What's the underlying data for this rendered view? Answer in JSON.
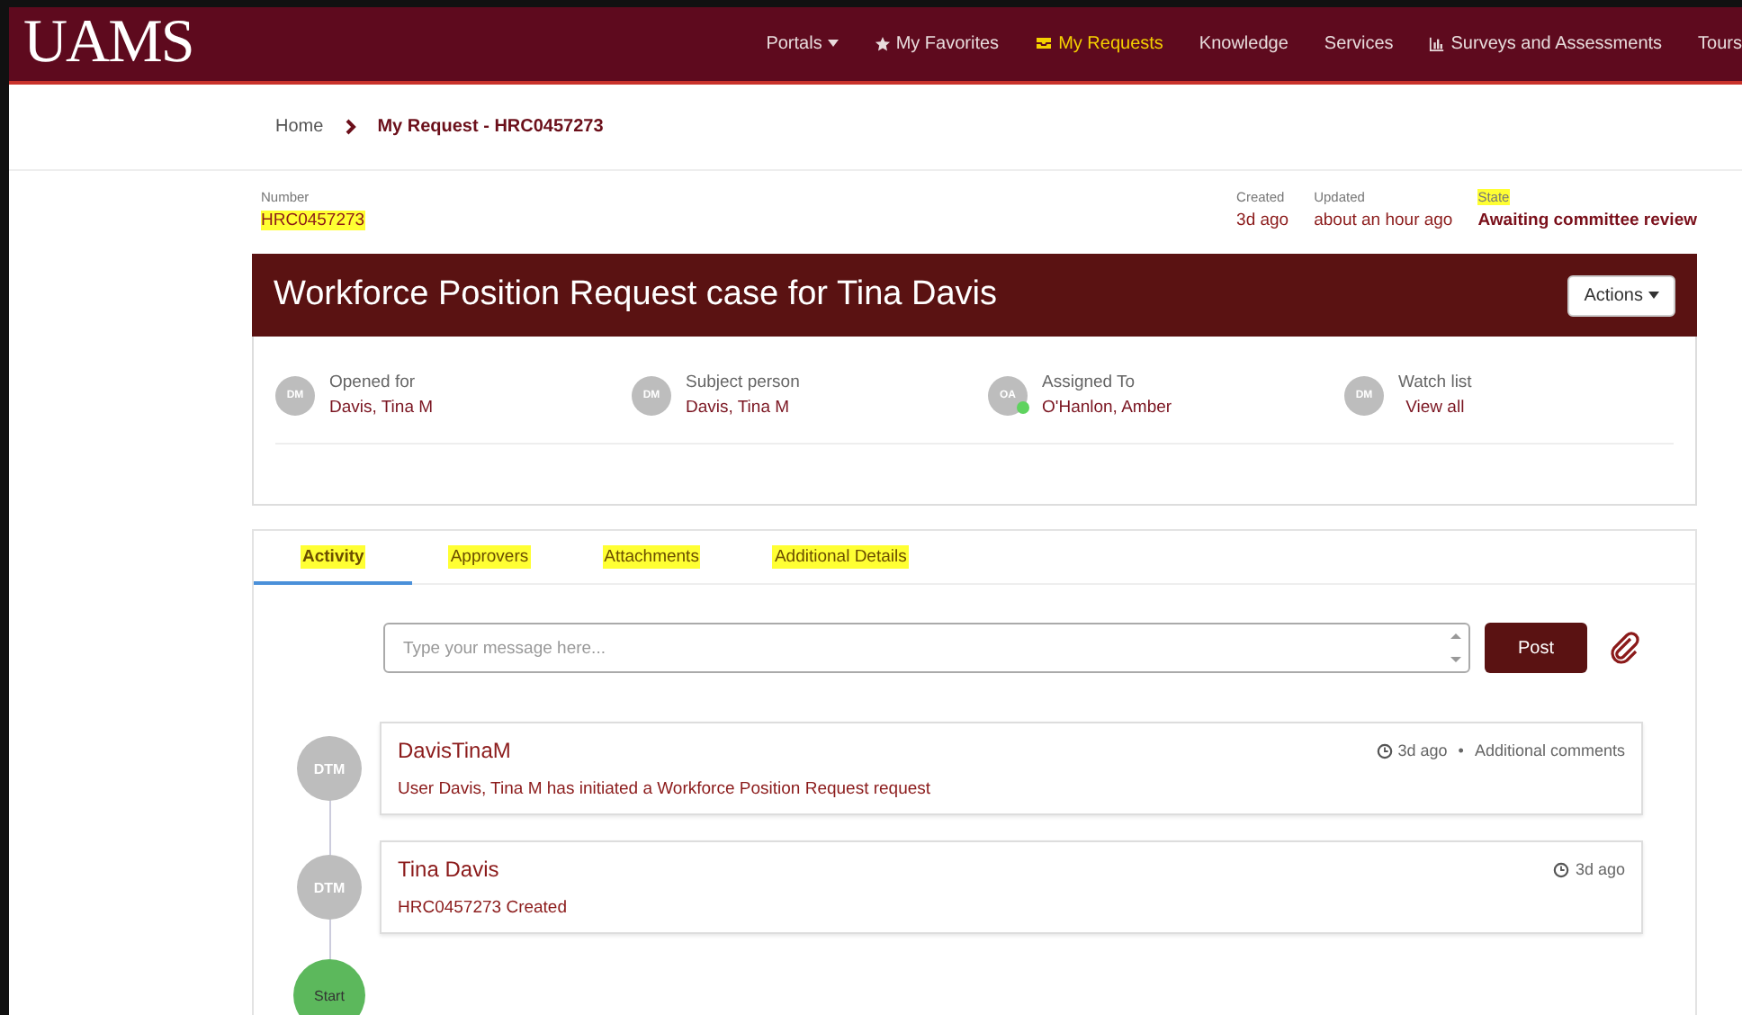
{
  "nav": {
    "logo": "UAMS",
    "items": [
      {
        "label": "Portals",
        "kind": "dropdown",
        "selected": false
      },
      {
        "label": "My Favorites",
        "kind": "favorites",
        "selected": false
      },
      {
        "label": "My Requests",
        "kind": "requests",
        "selected": true
      },
      {
        "label": "Knowledge",
        "kind": "plain",
        "selected": false
      },
      {
        "label": "Services",
        "kind": "plain",
        "selected": false
      },
      {
        "label": "Surveys and Assessments",
        "kind": "surveys",
        "selected": false
      },
      {
        "label": "Tours",
        "kind": "plain",
        "selected": false
      }
    ]
  },
  "breadcrumb": [
    {
      "label": "Home",
      "current": false
    },
    {
      "label": "My Request - HRC0457273",
      "current": true
    }
  ],
  "record": {
    "number": {
      "label": "Number",
      "value": "HRC0457273",
      "highlighted": true
    },
    "meta": [
      {
        "label": "Created",
        "value": "3d ago",
        "highlighted": false,
        "emphasis": false
      },
      {
        "label": "Updated",
        "value": "about an hour ago",
        "highlighted": false,
        "emphasis": false
      },
      {
        "label": "State",
        "value": "Awaiting committee review",
        "highlighted": true,
        "emphasis": true
      }
    ]
  },
  "case": {
    "title": "Workforce Position Request case for Tina Davis",
    "actions": "Actions",
    "people": [
      {
        "initials": "DM",
        "label": "Opened for",
        "value": "Davis, Tina M",
        "online": false
      },
      {
        "initials": "DM",
        "label": "Subject person",
        "value": "Davis, Tina M",
        "online": false
      },
      {
        "initials": "OA",
        "label": "Assigned To",
        "value": "O'Hanlon, Amber",
        "online": true
      },
      {
        "initials": "DM",
        "label": "Watch list",
        "value": "View all",
        "online": false
      }
    ]
  },
  "tabs": [
    {
      "label": "Activity",
      "selected": true,
      "highlighted": true
    },
    {
      "label": "Approvers",
      "selected": false,
      "highlighted": true
    },
    {
      "label": "Attachments",
      "selected": false,
      "highlighted": true
    },
    {
      "label": "Additional Details",
      "selected": false,
      "highlighted": true
    }
  ],
  "composer": {
    "placeholder": "Type your message here...",
    "post": "Post"
  },
  "activity": [
    {
      "initials": "DTM",
      "author": "DavisTinaM",
      "time": "3d ago",
      "separator": "•",
      "type": "Additional comments",
      "text": "User Davis, Tina M has initiated a Workforce Position Request request"
    },
    {
      "initials": "DTM",
      "author": "Tina Davis",
      "time": "3d ago",
      "text": "HRC0457273 Created"
    }
  ],
  "start": "Start"
}
